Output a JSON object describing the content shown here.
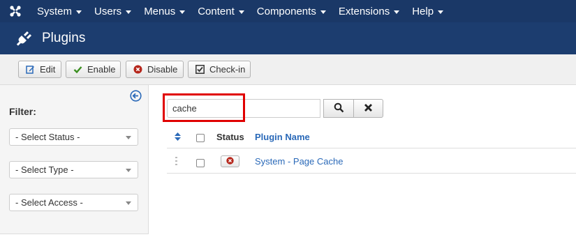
{
  "topnav": {
    "logo_icon": "joomla-logo-icon",
    "items": [
      {
        "label": "System"
      },
      {
        "label": "Users"
      },
      {
        "label": "Menus"
      },
      {
        "label": "Content"
      },
      {
        "label": "Components"
      },
      {
        "label": "Extensions"
      },
      {
        "label": "Help"
      }
    ]
  },
  "header": {
    "icon": "plug-icon",
    "title": "Plugins"
  },
  "toolbar": {
    "edit_label": "Edit",
    "enable_label": "Enable",
    "disable_label": "Disable",
    "checkin_label": "Check-in"
  },
  "sidebar": {
    "filter_label": "Filter:",
    "status_select": "- Select Status -",
    "type_select": "- Select Type -",
    "access_select": "- Select Access -"
  },
  "search": {
    "value": "cache",
    "placeholder": ""
  },
  "table": {
    "headers": {
      "status": "Status",
      "name": "Plugin Name"
    },
    "rows": [
      {
        "name": "System - Page Cache",
        "status": "disabled"
      }
    ]
  },
  "colors": {
    "nav_bg": "#1a3867",
    "header_bg": "#1c3d6f",
    "link": "#2a69b8",
    "highlight": "#e00000"
  }
}
